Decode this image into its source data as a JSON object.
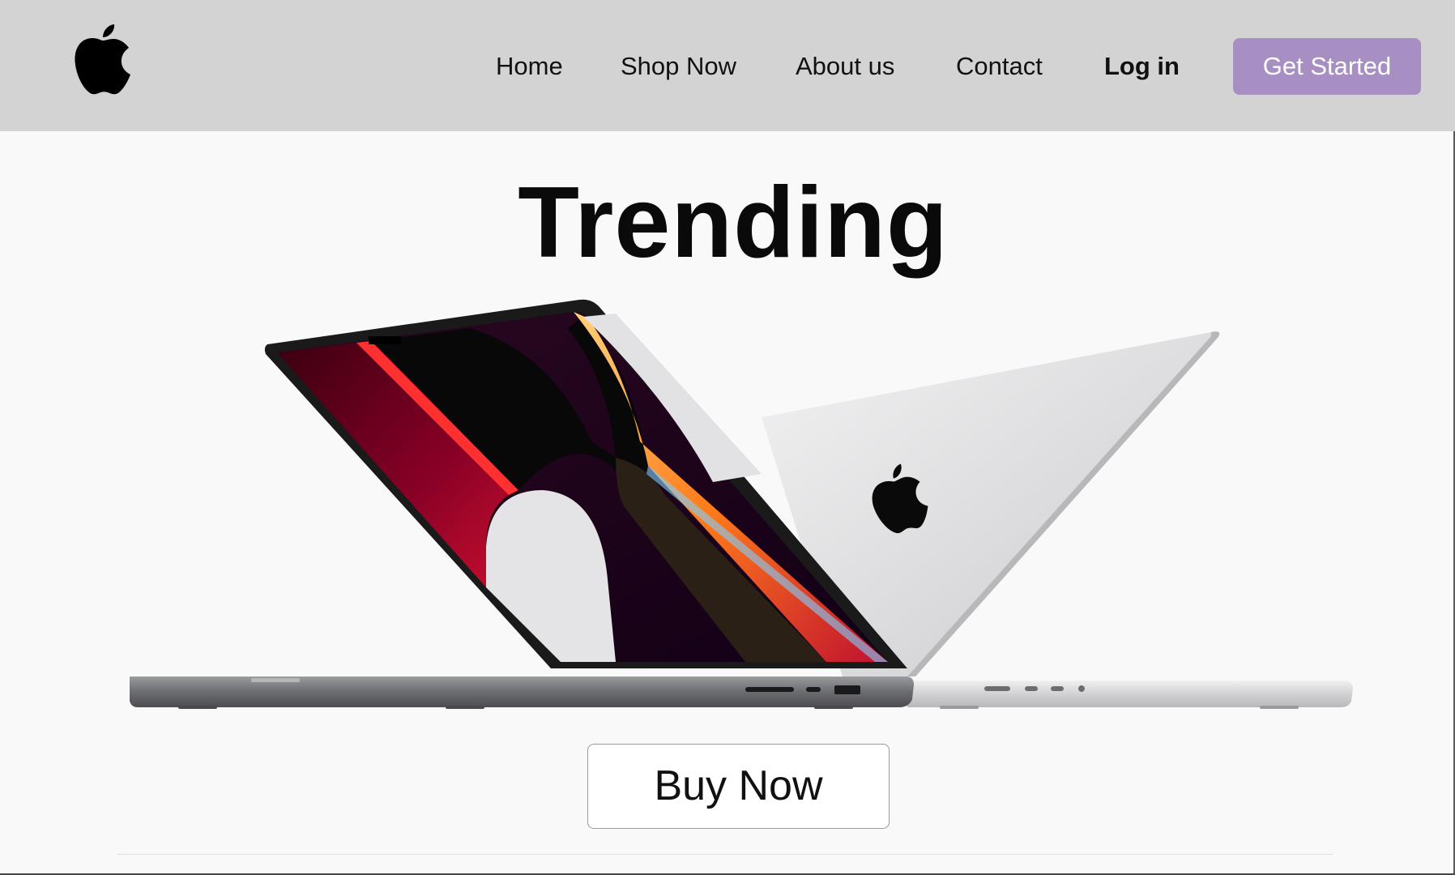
{
  "header": {
    "logo_icon": "apple-logo-icon",
    "nav": {
      "home": "Home",
      "shop_now": "Shop Now",
      "about_us": "About us",
      "contact": "Contact",
      "log_in": "Log in"
    },
    "cta_label": "Get Started",
    "background_color": "#d3d3d3",
    "cta_color": "#a78fc4"
  },
  "hero": {
    "title": "Trending",
    "image": "two-open-laptops-image",
    "buy_label": "Buy Now"
  }
}
